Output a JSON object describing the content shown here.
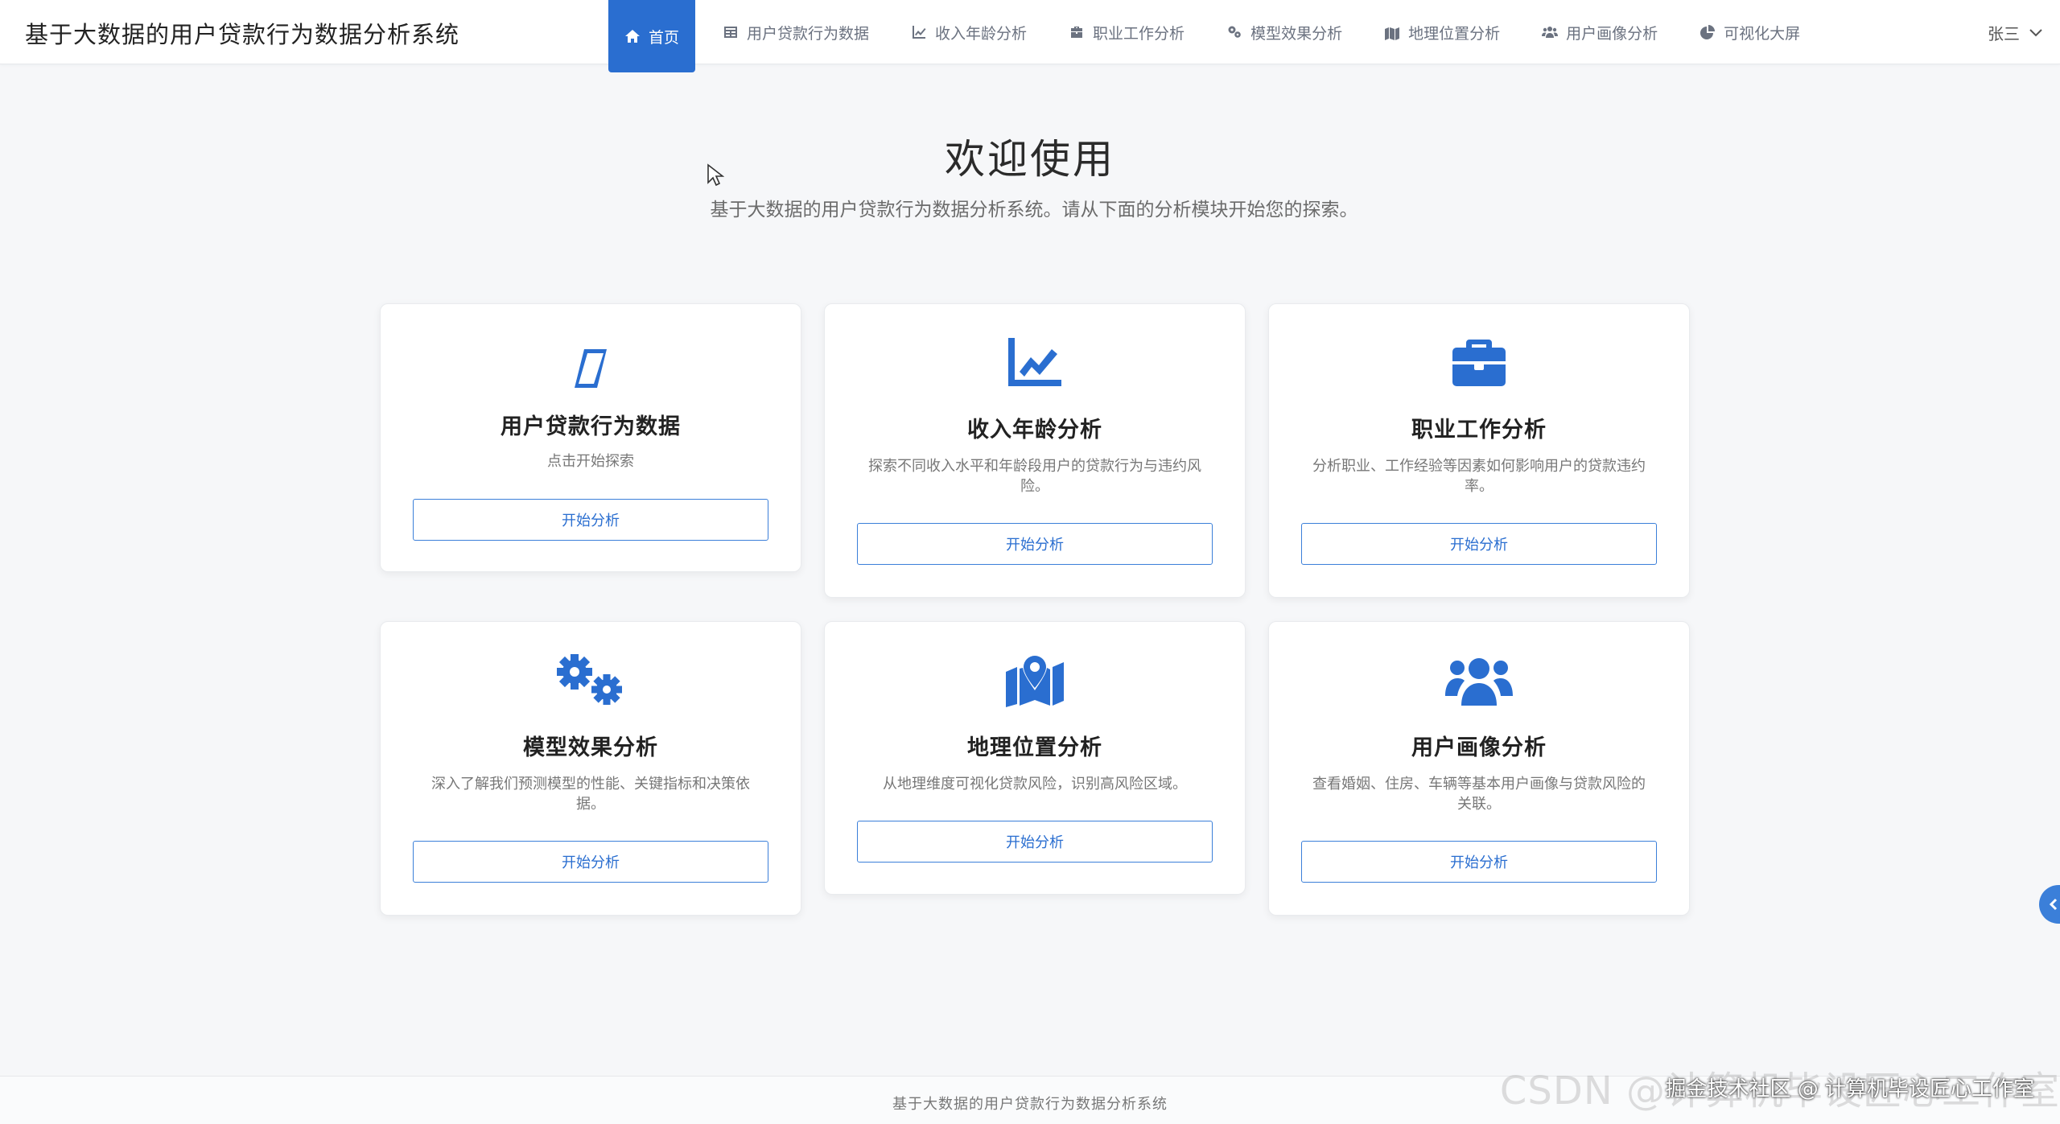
{
  "app": {
    "title": "基于大数据的用户贷款行为数据分析系统"
  },
  "nav": {
    "items": [
      {
        "label": "首页",
        "icon": "home-icon",
        "active": true
      },
      {
        "label": "用户贷款行为数据",
        "icon": "table-icon"
      },
      {
        "label": "收入年龄分析",
        "icon": "line-chart-icon"
      },
      {
        "label": "职业工作分析",
        "icon": "briefcase-icon"
      },
      {
        "label": "模型效果分析",
        "icon": "cogs-icon"
      },
      {
        "label": "地理位置分析",
        "icon": "map-icon"
      },
      {
        "label": "用户画像分析",
        "icon": "users-icon"
      },
      {
        "label": "可视化大屏",
        "icon": "pie-chart-icon"
      }
    ]
  },
  "user": {
    "name": "张三",
    "icon": "chevron-down-icon"
  },
  "hero": {
    "title": "欢迎使用",
    "subtitle": "基于大数据的用户贷款行为数据分析系统。请从下面的分析模块开始您的探索。"
  },
  "cards": [
    {
      "title": "用户贷款行为数据",
      "desc": "点击开始探索",
      "button": "开始分析",
      "icon": "parallelogram-icon"
    },
    {
      "title": "收入年龄分析",
      "desc": "探索不同收入水平和年龄段用户的贷款行为与违约风险。",
      "button": "开始分析",
      "icon": "line-chart-icon"
    },
    {
      "title": "职业工作分析",
      "desc": "分析职业、工作经验等因素如何影响用户的贷款违约率。",
      "button": "开始分析",
      "icon": "briefcase-icon"
    },
    {
      "title": "模型效果分析",
      "desc": "深入了解我们预测模型的性能、关键指标和决策依据。",
      "button": "开始分析",
      "icon": "cogs-icon"
    },
    {
      "title": "地理位置分析",
      "desc": "从地理维度可视化贷款风险，识别高风险区域。",
      "button": "开始分析",
      "icon": "map-icon"
    },
    {
      "title": "用户画像分析",
      "desc": "查看婚姻、住房、车辆等基本用户画像与贷款风险的关联。",
      "button": "开始分析",
      "icon": "users-icon"
    }
  ],
  "footer": {
    "text": "基于大数据的用户贷款行为数据分析系统"
  },
  "watermark": {
    "text": "CSDN @计算机毕设匠心工作室",
    "overlay": "掘金技术社区 @ 计算机毕设匠心工作室"
  },
  "colors": {
    "primary": "#2a6ed0",
    "background": "#f6f7f9"
  }
}
